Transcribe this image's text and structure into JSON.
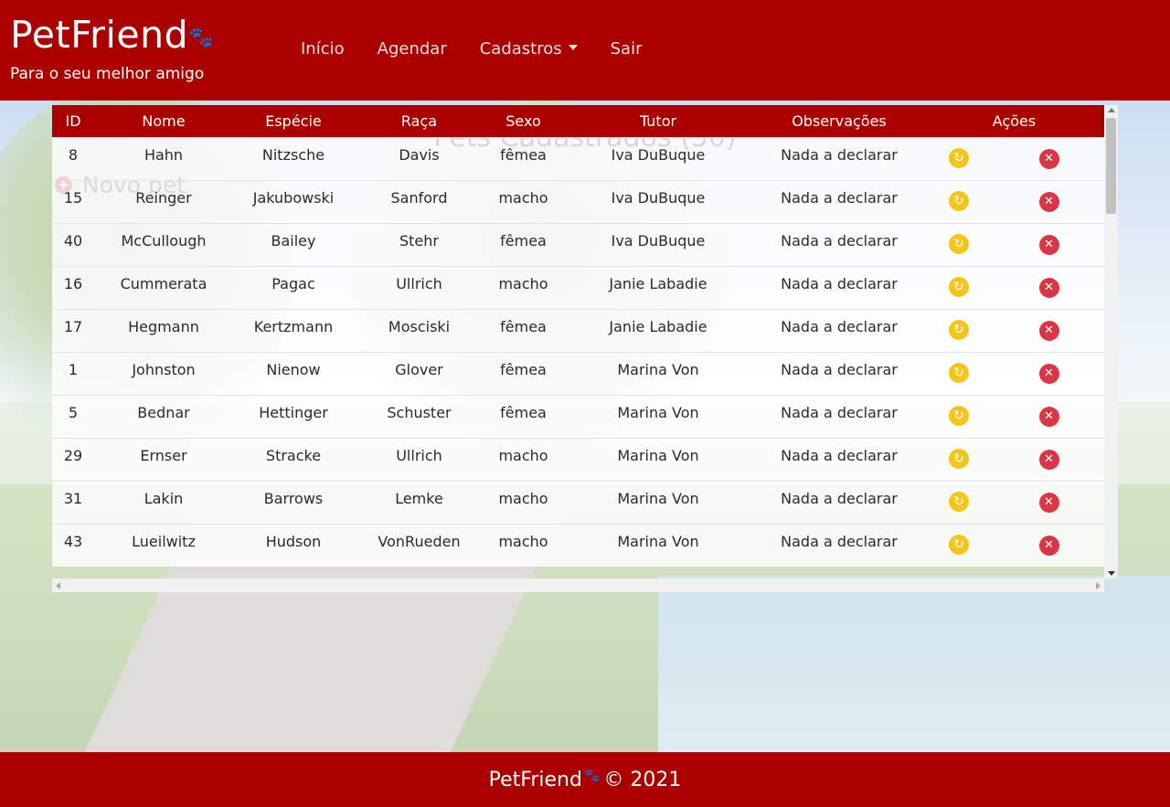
{
  "header": {
    "brand_title": "PetFriend",
    "brand_icon": "paw-icon",
    "brand_subtitle": "Para o seu melhor amigo",
    "nav": [
      {
        "label": "Início"
      },
      {
        "label": "Agendar"
      },
      {
        "label": "Cadastros"
      },
      {
        "label": "Sair"
      }
    ]
  },
  "main": {
    "title": "Pets Cadastrados (50)",
    "new_pet_label": "Novo pet",
    "table": {
      "columns": [
        "ID",
        "Nome",
        "Espécie",
        "Raça",
        "Sexo",
        "Tutor",
        "Observações",
        "Ações"
      ],
      "rows": [
        {
          "id": "8",
          "nome": "Hahn",
          "especie": "Nitzsche",
          "raca": "Davis",
          "sexo": "fêmea",
          "tutor": "Iva DuBuque",
          "obs": "Nada a declarar"
        },
        {
          "id": "15",
          "nome": "Reinger",
          "especie": "Jakubowski",
          "raca": "Sanford",
          "sexo": "macho",
          "tutor": "Iva DuBuque",
          "obs": "Nada a declarar"
        },
        {
          "id": "40",
          "nome": "McCullough",
          "especie": "Bailey",
          "raca": "Stehr",
          "sexo": "fêmea",
          "tutor": "Iva DuBuque",
          "obs": "Nada a declarar"
        },
        {
          "id": "16",
          "nome": "Cummerata",
          "especie": "Pagac",
          "raca": "Ullrich",
          "sexo": "macho",
          "tutor": "Janie Labadie",
          "obs": "Nada a declarar"
        },
        {
          "id": "17",
          "nome": "Hegmann",
          "especie": "Kertzmann",
          "raca": "Mosciski",
          "sexo": "fêmea",
          "tutor": "Janie Labadie",
          "obs": "Nada a declarar"
        },
        {
          "id": "1",
          "nome": "Johnston",
          "especie": "Nienow",
          "raca": "Glover",
          "sexo": "fêmea",
          "tutor": "Marina Von",
          "obs": "Nada a declarar"
        },
        {
          "id": "5",
          "nome": "Bednar",
          "especie": "Hettinger",
          "raca": "Schuster",
          "sexo": "fêmea",
          "tutor": "Marina Von",
          "obs": "Nada a declarar"
        },
        {
          "id": "29",
          "nome": "Ernser",
          "especie": "Stracke",
          "raca": "Ullrich",
          "sexo": "macho",
          "tutor": "Marina Von",
          "obs": "Nada a declarar"
        },
        {
          "id": "31",
          "nome": "Lakin",
          "especie": "Barrows",
          "raca": "Lemke",
          "sexo": "macho",
          "tutor": "Marina Von",
          "obs": "Nada a declarar"
        },
        {
          "id": "43",
          "nome": "Lueilwitz",
          "especie": "Hudson",
          "raca": "VonRueden",
          "sexo": "macho",
          "tutor": "Marina Von",
          "obs": "Nada a declarar"
        }
      ],
      "action_icons": [
        "refresh-icon",
        "close-icon"
      ]
    }
  },
  "footer": {
    "brand": "PetFriend",
    "copyright": "© 2021"
  },
  "colors": {
    "brand_red": "#aa0000",
    "edit_yellow": "#f5c518",
    "delete_red": "#dc3545"
  }
}
